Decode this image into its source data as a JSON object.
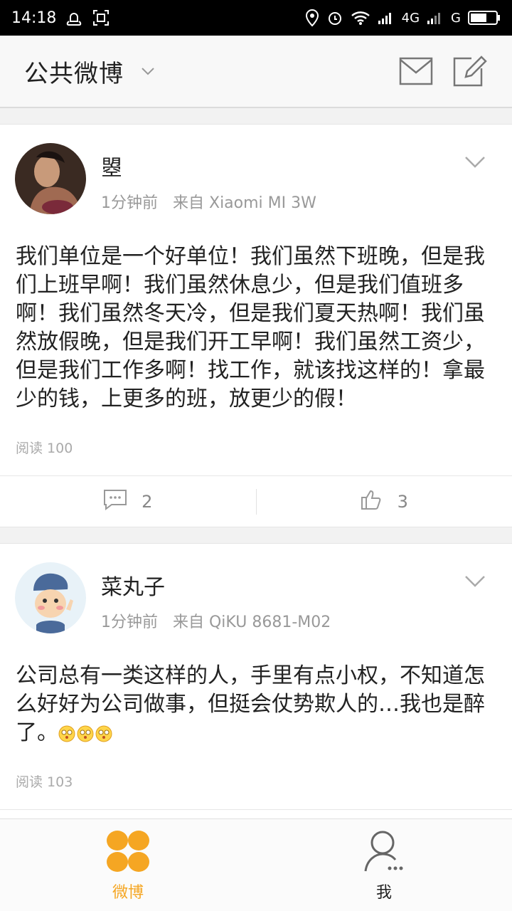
{
  "status_bar": {
    "time": "14:18",
    "network": "4G",
    "carrier_letter": "G"
  },
  "header": {
    "title": "公共微博",
    "icons": [
      "chevron-down-icon",
      "mail-icon",
      "compose-icon"
    ]
  },
  "posts": [
    {
      "author": "曌",
      "time": "1分钟前",
      "source": "来自 Xiaomi MI 3W",
      "text": "我们单位是一个好单位！我们虽然下班晚，但是我们上班早啊！我们虽然休息少，但是我们值班多啊！我们虽然冬天冷，但是我们夏天热啊！我们虽然放假晚，但是我们开工早啊！我们虽然工资少，但是我们工作多啊！找工作，就该找这样的！拿最少的钱，上更多的班，放更少的假！",
      "reads": "阅读 100",
      "comments": "2",
      "likes": "3"
    },
    {
      "author": "菜丸子",
      "time": "1分钟前",
      "source": "来自 QiKU 8681-M02",
      "text": "公司总有一类这样的人，手里有点小权，不知道怎么好好为公司做事，但挺会仗势欺人的…我也是醉了。",
      "emoji_count": 3,
      "reads": "阅读 103"
    }
  ],
  "tabbar": {
    "weibo_label": "微博",
    "me_label": "我",
    "active_color": "#f5a623"
  }
}
